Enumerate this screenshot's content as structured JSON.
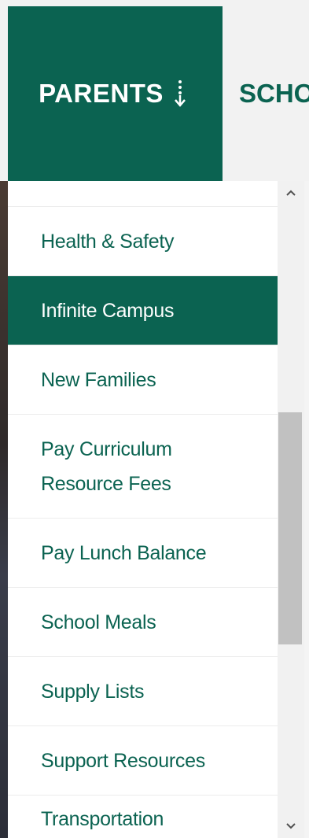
{
  "nav": {
    "parents_label": "PARENTS",
    "schools_label": "SCHO",
    "brand_color": "#0b6351"
  },
  "dropdown": {
    "items": [
      {
        "label": "Health & Safety",
        "active": false
      },
      {
        "label": "Infinite Campus",
        "active": true
      },
      {
        "label": "New Families",
        "active": false
      },
      {
        "label": "Pay Curriculum Resource Fees",
        "active": false
      },
      {
        "label": "Pay Lunch Balance",
        "active": false
      },
      {
        "label": "School Meals",
        "active": false
      },
      {
        "label": "Supply Lists",
        "active": false
      },
      {
        "label": "Support Resources",
        "active": false
      },
      {
        "label": "Transportation",
        "active": false
      }
    ]
  },
  "scrollbar": {
    "position_fraction": 0.55,
    "visible_fraction": 0.38
  }
}
